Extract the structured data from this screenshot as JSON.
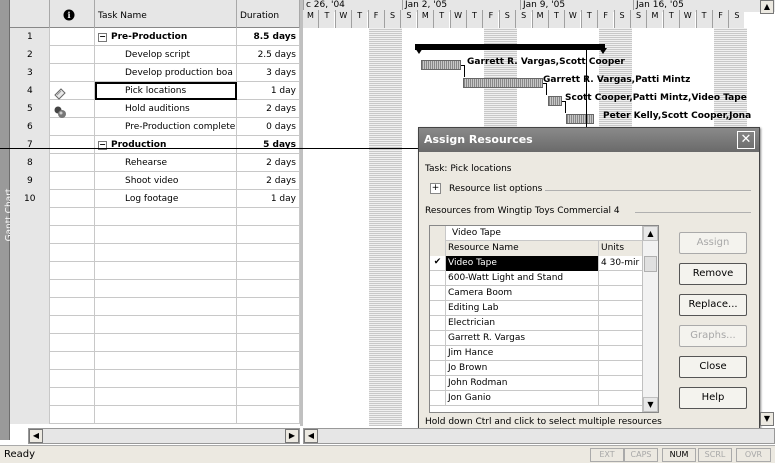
{
  "sidebar": {
    "label": "Gantt Chart"
  },
  "table": {
    "headers": {
      "info_icon": "info-icon",
      "task_name": "Task Name",
      "duration": "Duration"
    },
    "rows": [
      {
        "id": "1",
        "name": "Pre-Production",
        "duration": "8.5 days",
        "summary": true,
        "indicator": ""
      },
      {
        "id": "2",
        "name": "Develop script",
        "duration": "2.5 days",
        "summary": false,
        "indicator": ""
      },
      {
        "id": "3",
        "name": "Develop production boa",
        "duration": "3 days",
        "summary": false,
        "indicator": ""
      },
      {
        "id": "4",
        "name": "Pick locations",
        "duration": "1 day",
        "summary": false,
        "indicator": "note-icon"
      },
      {
        "id": "5",
        "name": "Hold auditions",
        "duration": "2 days",
        "summary": false,
        "indicator": "resource-icon"
      },
      {
        "id": "6",
        "name": "Pre-Production complete",
        "duration": "0 days",
        "summary": false,
        "indicator": ""
      },
      {
        "id": "7",
        "name": "Production",
        "duration": "5 days",
        "summary": true,
        "indicator": ""
      },
      {
        "id": "8",
        "name": "Rehearse",
        "duration": "2 days",
        "summary": false,
        "indicator": ""
      },
      {
        "id": "9",
        "name": "Shoot video",
        "duration": "2 days",
        "summary": false,
        "indicator": ""
      },
      {
        "id": "10",
        "name": "Log footage",
        "duration": "1 day",
        "summary": false,
        "indicator": ""
      }
    ]
  },
  "timescale": {
    "weeks": [
      "c 26, '04",
      "Jan 2, '05",
      "Jan 9, '05",
      "Jan 16, '05"
    ],
    "days": [
      "M",
      "T",
      "W",
      "T",
      "F",
      "S",
      "S",
      "M",
      "T",
      "W",
      "T",
      "F",
      "S",
      "S",
      "M",
      "T",
      "W",
      "T",
      "F",
      "S",
      "S",
      "M",
      "T",
      "W",
      "T",
      "F",
      "S"
    ]
  },
  "gantt_labels": [
    "Garrett R. Vargas,Scott Cooper",
    "Garrett R. Vargas,Patti Mintz",
    "Scott Cooper,Patti Mintz,Video Tape",
    "Peter Kelly,Scott Cooper,Jona"
  ],
  "dialog": {
    "title": "Assign Resources",
    "task_label": "Task: Pick locations",
    "options_label": "Resource list options",
    "resources_from": "Resources from Wingtip Toys Commercial 4",
    "filter_value": "Video Tape",
    "columns": {
      "name": "Resource Name",
      "units": "Units"
    },
    "resources": [
      {
        "check": "✔",
        "name": "Video Tape",
        "units": "4 30-mir",
        "selected": true
      },
      {
        "check": "",
        "name": "600-Watt Light and Stand",
        "units": "",
        "selected": false
      },
      {
        "check": "",
        "name": "Camera Boom",
        "units": "",
        "selected": false
      },
      {
        "check": "",
        "name": "Editing Lab",
        "units": "",
        "selected": false
      },
      {
        "check": "",
        "name": "Electrician",
        "units": "",
        "selected": false
      },
      {
        "check": "",
        "name": "Garrett R. Vargas",
        "units": "",
        "selected": false
      },
      {
        "check": "",
        "name": "Jim Hance",
        "units": "",
        "selected": false
      },
      {
        "check": "",
        "name": "Jo Brown",
        "units": "",
        "selected": false
      },
      {
        "check": "",
        "name": "John Rodman",
        "units": "",
        "selected": false
      },
      {
        "check": "",
        "name": "Jon Ganio",
        "units": "",
        "selected": false
      }
    ],
    "buttons": {
      "assign": "Assign",
      "remove": "Remove",
      "replace": "Replace...",
      "graphs": "Graphs...",
      "close": "Close",
      "help": "Help"
    },
    "hint": "Hold down Ctrl and click to select multiple resources"
  },
  "status": {
    "ready": "Ready",
    "indicators": [
      {
        "label": "EXT",
        "active": false
      },
      {
        "label": "CAPS",
        "active": false
      },
      {
        "label": "NUM",
        "active": true
      },
      {
        "label": "SCRL",
        "active": false
      },
      {
        "label": "OVR",
        "active": false
      }
    ]
  }
}
